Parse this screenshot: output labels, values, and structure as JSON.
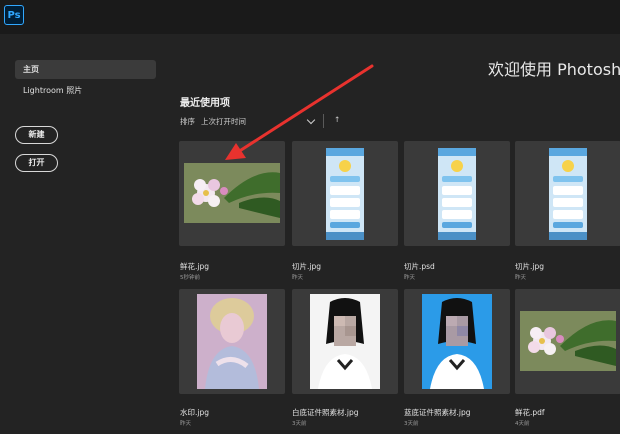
{
  "app": {
    "logo": "Ps"
  },
  "sidebar": {
    "nav": [
      {
        "label": "主页",
        "active": true
      },
      {
        "label": "Lightroom 照片",
        "active": false
      }
    ],
    "new_label": "新建",
    "open_label": "打开"
  },
  "main": {
    "welcome": "欢迎使用 Photoshop",
    "recent_title": "最近使用项",
    "sort": {
      "label": "排序",
      "value": "上次打开时间",
      "direction_icon": "↑"
    },
    "files": [
      {
        "name": "鲜花.jpg",
        "time": "5秒钟前",
        "thumb": "flower-photo"
      },
      {
        "name": "切片.jpg",
        "time": "昨天",
        "thumb": "web-mockup"
      },
      {
        "name": "切片.psd",
        "time": "昨天",
        "thumb": "web-mockup"
      },
      {
        "name": "切片.jpg",
        "time": "昨天",
        "thumb": "web-mockup"
      },
      {
        "name": "水印.jpg",
        "time": "昨天",
        "thumb": "portrait-watermark"
      },
      {
        "name": "白底证件照素材.jpg",
        "time": "3天前",
        "thumb": "id-photo-white"
      },
      {
        "name": "蓝底证件照素材.jpg",
        "time": "3天前",
        "thumb": "id-photo-blue"
      },
      {
        "name": "鲜花.pdf",
        "time": "4天前",
        "thumb": "flower-photo"
      }
    ]
  },
  "colors": {
    "background": "#232323",
    "card": "#3a3a3a",
    "accent_arrow": "#e8322e",
    "ps_blue": "#31a8ff"
  }
}
